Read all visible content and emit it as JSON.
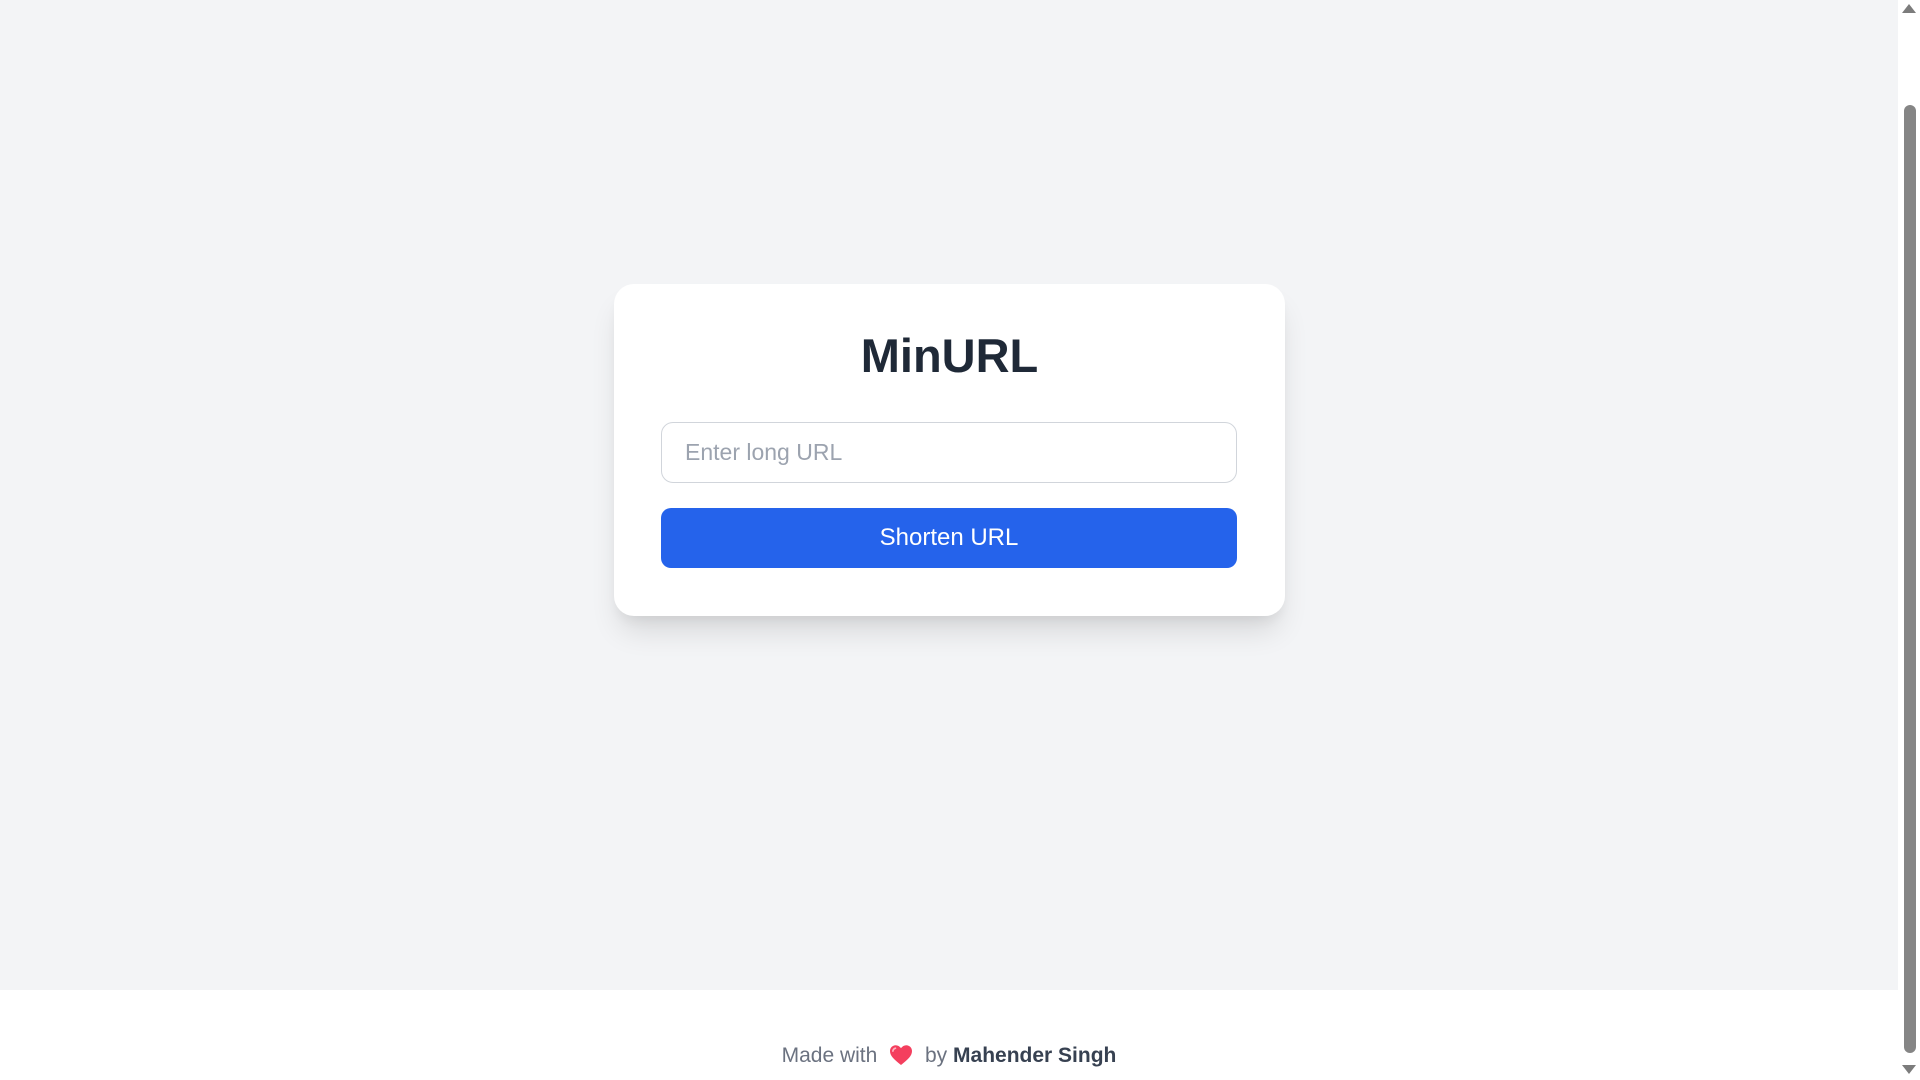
{
  "app": {
    "title": "MinURL"
  },
  "form": {
    "url_input": {
      "placeholder": "Enter long URL",
      "value": ""
    },
    "submit_label": "Shorten URL"
  },
  "footer": {
    "prefix": "Made with",
    "heart_icon": "heart-icon",
    "by_text": "by",
    "author": "Mahender Singh"
  },
  "colors": {
    "background": "#f3f4f6",
    "card": "#ffffff",
    "title": "#1f2937",
    "accent": "#2563eb",
    "heart": "#f43f5e",
    "muted_text": "#6b7280"
  }
}
